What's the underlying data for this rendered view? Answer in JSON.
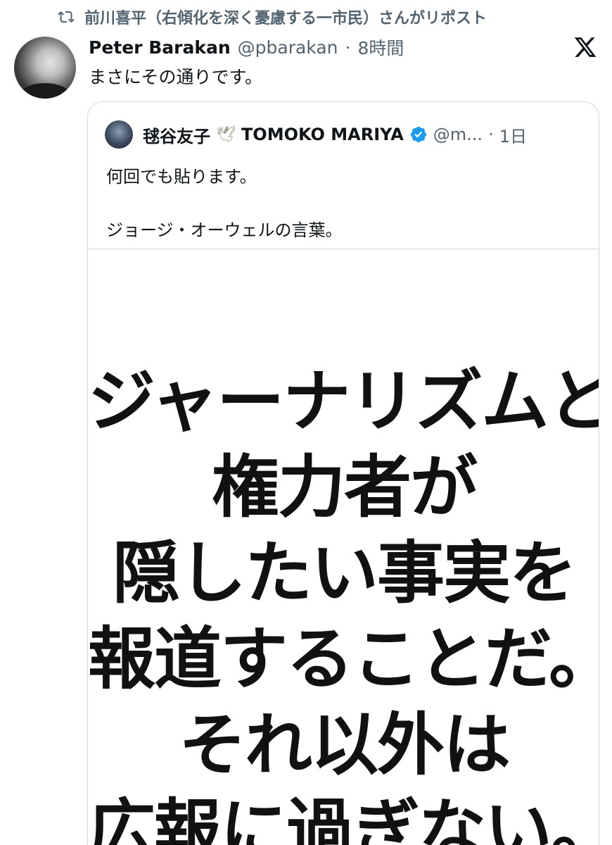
{
  "repost": {
    "icon": "repost-icon",
    "text": "前川喜平（右傾化を深く憂慮する一市民）さんがリポスト"
  },
  "tweet": {
    "author_name": "Peter Barakan",
    "handle": "@pbarakan",
    "separator": "·",
    "time": "8時間",
    "text": "まさにその通りです。"
  },
  "quoted": {
    "name": "毬谷友子",
    "emoji": "🕊",
    "name_latin": "TOMOKO MARIYA",
    "verified": true,
    "handle": "@m...",
    "separator": "·",
    "time": "1日",
    "text_line1": "何回でも貼ります。",
    "text_line2": "ジョージ・オーウェルの言葉。",
    "image_lines": [
      "ジャーナリズムとは",
      "権力者が",
      "隠したい事実を",
      "報道することだ。",
      "それ以外は",
      "広報に過ぎない。"
    ]
  },
  "colors": {
    "text": "#0f1419",
    "secondary": "#536471",
    "border": "#cfd9de",
    "verified": "#1d9bf0"
  }
}
